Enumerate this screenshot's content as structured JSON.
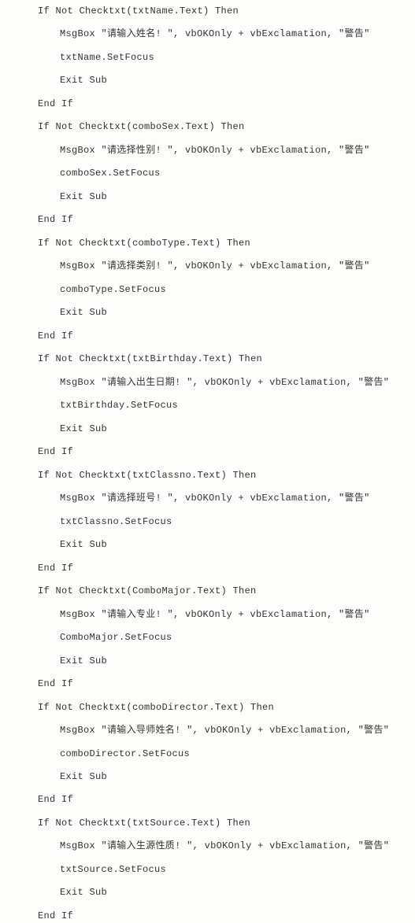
{
  "blocks": [
    {
      "if_line": "If Not Checktxt(txtName.Text) Then",
      "msgbox_line": "MsgBox \"请输入姓名! \", vbOKOnly + vbExclamation, \"警告\"",
      "setfocus_line": "txtName.SetFocus",
      "exit_line": "Exit Sub",
      "end_line": "End If"
    },
    {
      "if_line": "If Not Checktxt(comboSex.Text) Then",
      "msgbox_line": "MsgBox \"请选择性别! \", vbOKOnly + vbExclamation, \"警告\"",
      "setfocus_line": "comboSex.SetFocus",
      "exit_line": "Exit Sub",
      "end_line": "End If"
    },
    {
      "if_line": "If Not Checktxt(comboType.Text) Then",
      "msgbox_line": "MsgBox \"请选择类别! \", vbOKOnly + vbExclamation, \"警告\"",
      "setfocus_line": "comboType.SetFocus",
      "exit_line": "Exit Sub",
      "end_line": "End If"
    },
    {
      "if_line": "If Not Checktxt(txtBirthday.Text) Then",
      "msgbox_line": "MsgBox \"请输入出生日期! \", vbOKOnly + vbExclamation, \"警告\"",
      "setfocus_line": "txtBirthday.SetFocus",
      "exit_line": "Exit Sub",
      "end_line": "End If"
    },
    {
      "if_line": "If Not Checktxt(txtClassno.Text) Then",
      "msgbox_line": "MsgBox \"请选择班号! \", vbOKOnly + vbExclamation, \"警告\"",
      "setfocus_line": "txtClassno.SetFocus",
      "exit_line": "Exit Sub",
      "end_line": "End If"
    },
    {
      "if_line": "If Not Checktxt(ComboMajor.Text) Then",
      "msgbox_line": "MsgBox \"请输入专业! \", vbOKOnly + vbExclamation, \"警告\"",
      "setfocus_line": "ComboMajor.SetFocus",
      "exit_line": "Exit Sub",
      "end_line": "End If"
    },
    {
      "if_line": "If Not Checktxt(comboDirector.Text) Then",
      "msgbox_line": "MsgBox \"请输入导师姓名! \", vbOKOnly + vbExclamation, \"警告\"",
      "setfocus_line": "comboDirector.SetFocus",
      "exit_line": "Exit Sub",
      "end_line": "End If"
    },
    {
      "if_line": "If Not Checktxt(txtSource.Text) Then",
      "msgbox_line": "MsgBox \"请输入生源性质! \", vbOKOnly + vbExclamation, \"警告\"",
      "setfocus_line": "txtSource.SetFocus",
      "exit_line": "Exit Sub",
      "end_line": "End If"
    }
  ]
}
